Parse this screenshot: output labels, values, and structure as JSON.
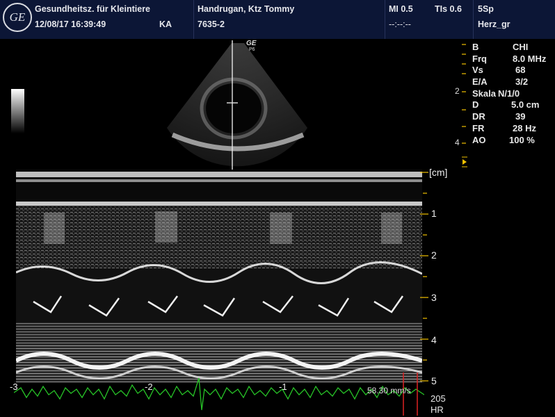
{
  "header": {
    "logo_text": "GE",
    "clinic": "Gesundheitsz. für Kleintiere",
    "datetime": "12/08/17 16:39:49",
    "operator": "KA",
    "patient": "Handrugan, Ktz Tommy",
    "patient_id": "7635-2",
    "mi": "MI 0.5",
    "tis": "TIs 0.6",
    "probe": "5Sp",
    "timer": "--:--:--",
    "preset": "Herz_gr"
  },
  "image": {
    "probe_brand": "GE",
    "probe_model": "P6"
  },
  "params": [
    {
      "k": "B",
      "v": "CHI"
    },
    {
      "k": "Frq",
      "v": "8.0 MHz"
    },
    {
      "k": "Vs",
      "v": "68"
    },
    {
      "k": "E/A",
      "v": "3/2"
    },
    {
      "k": "Skala",
      "v": "N/1/0"
    },
    {
      "k": "D",
      "v": "5.0 cm"
    },
    {
      "k": "DR",
      "v": "39"
    },
    {
      "k": "FR",
      "v": "28 Hz"
    },
    {
      "k": "AO",
      "v": "100 %"
    }
  ],
  "sector_ticks": [
    "2",
    "4"
  ],
  "mmode": {
    "unit": "[cm]",
    "depth_labels": [
      "1",
      "2",
      "3",
      "4",
      "5"
    ]
  },
  "timeline": {
    "labels": [
      "-3",
      "-2",
      "-1"
    ],
    "speed": "58.30 mm/s"
  },
  "hr": {
    "value": "205",
    "label": "HR"
  },
  "colors": {
    "header_bg": "#0c1636",
    "ecg": "#27c427",
    "marker": "#f2c200",
    "cursor": "#dd2222"
  }
}
